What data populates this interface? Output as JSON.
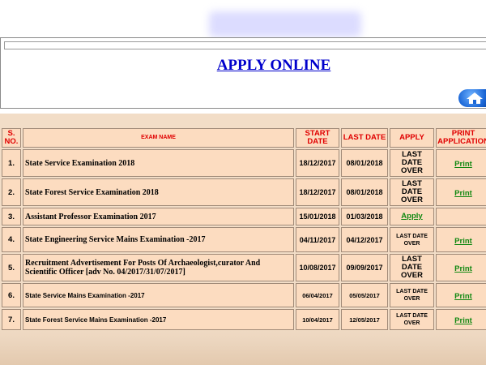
{
  "header": {
    "title": "APPLY ONLINE",
    "home_icon": "home-icon"
  },
  "table": {
    "headers": {
      "sno": "S. NO.",
      "exam_name": "EXAM NAME",
      "start_date": "START DATE",
      "last_date": "LAST DATE",
      "apply": "APPLY",
      "print": "PRINT APPLICATION"
    },
    "rows": [
      {
        "sno": "1.",
        "name": "State Service Examination 2018",
        "start": "18/12/2017",
        "last": "08/01/2018",
        "apply": "LAST DATE OVER",
        "print": "Print"
      },
      {
        "sno": "2.",
        "name": "State Forest Service Examination 2018",
        "start": "18/12/2017",
        "last": "08/01/2018",
        "apply": "LAST DATE OVER",
        "print": "Print"
      },
      {
        "sno": "3.",
        "name": "Assistant Professor Examination 2017",
        "start": "15/01/2018",
        "last": "01/03/2018",
        "apply": "Apply",
        "print": ""
      },
      {
        "sno": "4.",
        "name": "State Engineering Service Mains Examination -2017",
        "start": "04/11/2017",
        "last": "04/12/2017",
        "apply": "LAST DATE OVER",
        "print": "Print"
      },
      {
        "sno": "5.",
        "name": "Recruitment Advertisement For Posts Of Archaeologist,curator And Scientific Officer [adv No. 04/2017/31/07/2017]",
        "start": "10/08/2017",
        "last": "09/09/2017",
        "apply": "LAST DATE OVER",
        "print": "Print"
      },
      {
        "sno": "6.",
        "name": "State Service Mains Examination -2017",
        "start": "06/04/2017",
        "last": "05/05/2017",
        "apply": "LAST DATE OVER",
        "print": "Print"
      },
      {
        "sno": "7.",
        "name": "State Forest Service Mains Examination -2017",
        "start": "10/04/2017",
        "last": "12/05/2017",
        "apply": "LAST DATE OVER",
        "print": "Print"
      }
    ]
  },
  "colors": {
    "header_text": "#e00000",
    "link_green": "#118811",
    "title_blue": "#0000cc",
    "cell_bg": "#fcdcc0"
  }
}
